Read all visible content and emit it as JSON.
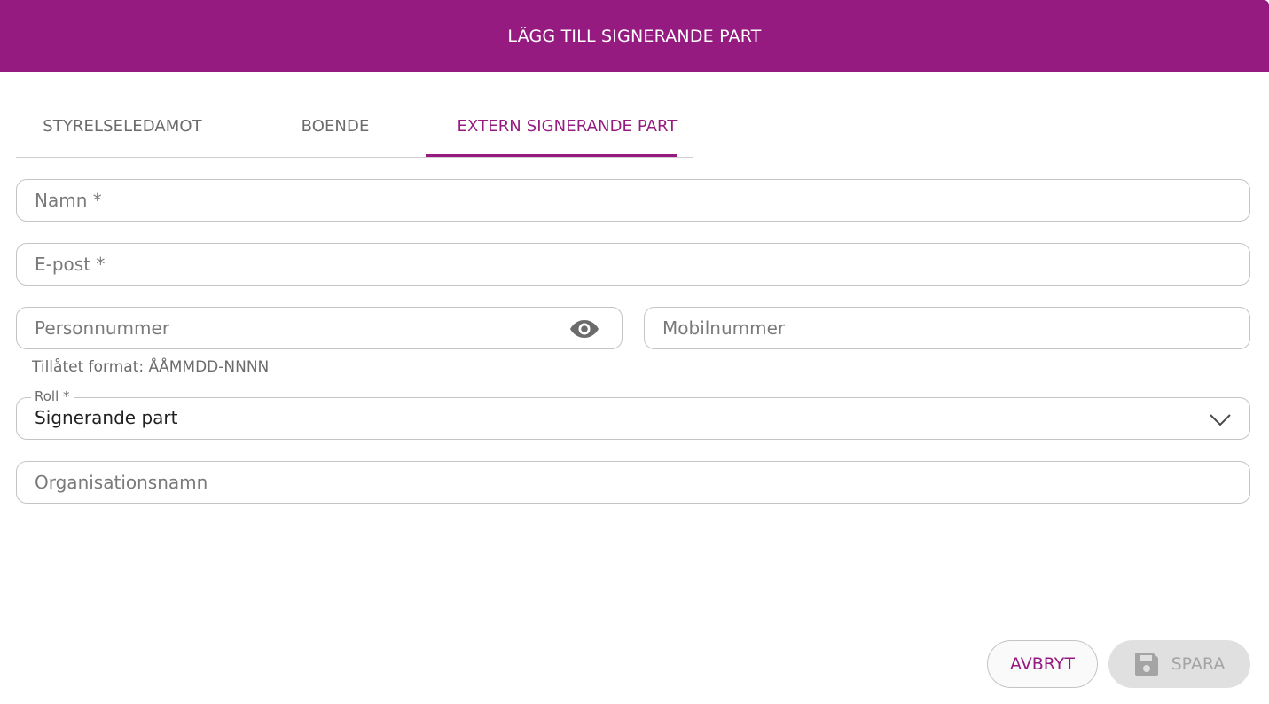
{
  "dialog": {
    "title": "LÄGG TILL SIGNERANDE PART"
  },
  "tabs": [
    {
      "label": "STYRELSELEDAMOT",
      "active": false
    },
    {
      "label": "BOENDE",
      "active": false
    },
    {
      "label": "EXTERN SIGNERANDE PART",
      "active": true
    }
  ],
  "form": {
    "name": {
      "placeholder": "Namn *",
      "value": ""
    },
    "email": {
      "placeholder": "E-post *",
      "value": ""
    },
    "personal_number": {
      "placeholder": "Personnummer",
      "value": "",
      "helper": "Tillåtet format: ÅÅMMDD-NNNN",
      "icon": "eye-icon"
    },
    "mobile": {
      "placeholder": "Mobilnummer",
      "value": ""
    },
    "role": {
      "label": "Roll *",
      "value": "Signerande part",
      "icon": "chevron-down-icon"
    },
    "organization": {
      "placeholder": "Organisationsnamn",
      "value": ""
    }
  },
  "actions": {
    "cancel_label": "AVBRYT",
    "save_label": "SPARA",
    "save_icon": "floppy-disk-icon",
    "save_disabled": true
  },
  "colors": {
    "brand": "#961b81",
    "disabled_bg": "#e0e0e0",
    "disabled_text": "#a4a4a4"
  }
}
